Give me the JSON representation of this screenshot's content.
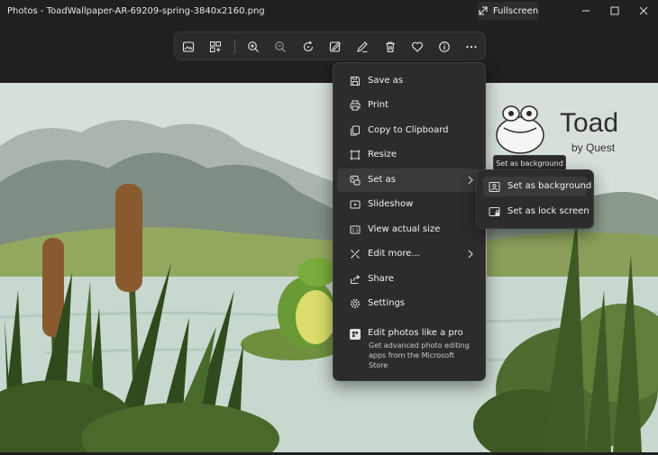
{
  "window": {
    "title": "Photos - ToadWallpaper-AR-69209-spring-3840x2160.png",
    "fullscreen_label": "Fullscreen"
  },
  "toolbar": {
    "icons": [
      "gallery-icon",
      "collage-icon",
      "zoom-in-icon",
      "zoom-out-icon",
      "rotate-icon",
      "edit-image-icon",
      "draw-icon",
      "delete-icon",
      "favorite-icon",
      "info-icon",
      "more-icon"
    ]
  },
  "image": {
    "logo_text": "Toad",
    "logo_sub": "by Quest"
  },
  "menu": {
    "items": [
      {
        "label": "Save as"
      },
      {
        "label": "Print"
      },
      {
        "label": "Copy to Clipboard"
      },
      {
        "label": "Resize"
      },
      {
        "label": "Set as"
      },
      {
        "label": "Slideshow"
      },
      {
        "label": "View actual size"
      },
      {
        "label": "Edit more..."
      },
      {
        "label": "Share"
      },
      {
        "label": "Settings"
      }
    ],
    "promo": {
      "title": "Edit photos like a pro",
      "description": "Get advanced photo editing apps from the Microsoft Store"
    }
  },
  "tooltip": {
    "text": "Set as background"
  },
  "submenu": {
    "items": [
      {
        "label": "Set as background"
      },
      {
        "label": "Set as lock screen"
      }
    ]
  }
}
